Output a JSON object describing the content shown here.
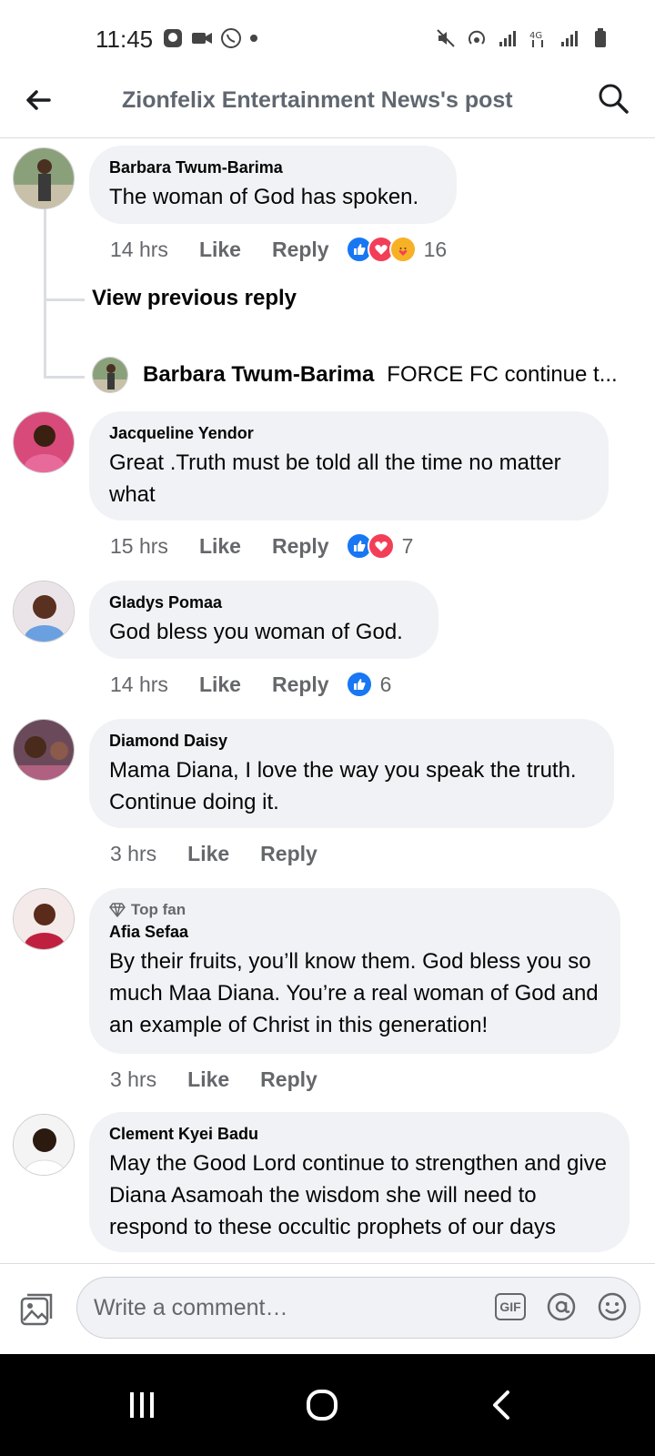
{
  "status_bar": {
    "time": "11:45"
  },
  "header": {
    "title": "Zionfelix Entertainment News's post"
  },
  "comments": [
    {
      "author": "Barbara Twum-Barima",
      "text": "The woman of God has spoken.",
      "time": "14 hrs",
      "like_label": "Like",
      "reply_label": "Reply",
      "reactions": [
        "like",
        "love",
        "care"
      ],
      "reaction_count": "16"
    },
    {
      "author": "Jacqueline Yendor",
      "text": "Great .Truth must be told all the time no matter what",
      "time": "15 hrs",
      "like_label": "Like",
      "reply_label": "Reply",
      "reactions": [
        "like",
        "love"
      ],
      "reaction_count": "7"
    },
    {
      "author": "Gladys Pomaa",
      "text": "God bless you woman of God.",
      "time": "14 hrs",
      "like_label": "Like",
      "reply_label": "Reply",
      "reactions": [
        "like"
      ],
      "reaction_count": "6"
    },
    {
      "author": "Diamond Daisy",
      "text": "Mama Diana, I love the way you speak the truth. Continue doing it.",
      "time": "3 hrs",
      "like_label": "Like",
      "reply_label": "Reply"
    },
    {
      "badge": "Top fan",
      "author": "Afia Sefaa",
      "text": "By their fruits, you’ll know them. God bless you so much Maa Diana. You’re a real woman of God and an example of Christ in this generation!",
      "time": "3 hrs",
      "like_label": "Like",
      "reply_label": "Reply"
    },
    {
      "author": "Clement Kyei Badu",
      "text": "May the Good Lord continue to strengthen and give Diana Asamoah the wisdom she will need to respond to these occultic prophets of our days"
    }
  ],
  "thread": {
    "view_previous_label": "View previous reply",
    "latest_reply_author": "Barbara Twum-Barima",
    "latest_reply_text": "FORCE FC continue t..."
  },
  "composer": {
    "placeholder": "Write a comment…",
    "gif_label": "GIF"
  },
  "colors": {
    "accent_blue": "#1877f2",
    "love_red": "#f33e58",
    "care_yellow": "#f7b125",
    "bubble_gray": "#f0f2f5"
  },
  "icons": {
    "back": "arrow-left-icon",
    "search": "search-icon",
    "photo": "photo-icon",
    "gif": "gif-icon",
    "mention": "at-icon",
    "emoji": "emoji-icon"
  }
}
